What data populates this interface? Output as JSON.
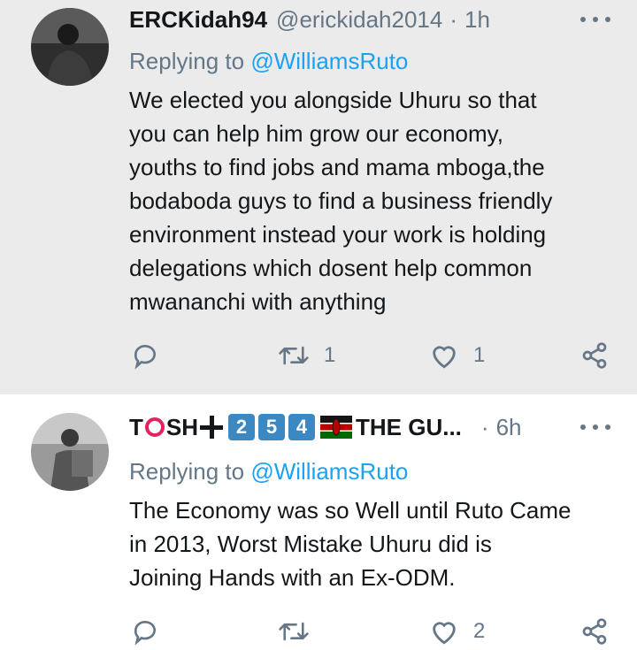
{
  "tweets": [
    {
      "author_name": "ERCKidah94",
      "handle": "@erickidah2014",
      "separator": "·",
      "time": "1h",
      "replying_prefix": "Replying to ",
      "replying_to": "@WilliamsRuto",
      "text": "We elected you alongside Uhuru so that\nyou can help him grow our economy,\nyouths to find jobs and mama mboga,the\nbodaboda guys to find a business friendly\nenvironment instead your work is holding\ndelegations which dosent help common\nmwananchi with anything",
      "retweets": "1",
      "likes": "1"
    },
    {
      "author_prefix_T": "T",
      "author_SH": "SH",
      "keycaps": [
        "2",
        "5",
        "4"
      ],
      "author_rest": "THE GU...",
      "separator": "·",
      "time": "6h",
      "replying_prefix": "Replying to ",
      "replying_to": "@WilliamsRuto",
      "text": "The Economy was so Well until Ruto Came\nin 2013, Worst  Mistake Uhuru did is\nJoining Hands with  an Ex-ODM.",
      "likes": "2"
    }
  ],
  "icons": {
    "reply": "reply-icon",
    "retweet": "retweet-icon",
    "like": "heart-icon",
    "share": "share-icon",
    "more": "more-dots-icon"
  },
  "colors": {
    "highlight_bg": "#ebebeb",
    "muted": "#657786",
    "link": "#1da1f2",
    "text": "#14171a"
  }
}
